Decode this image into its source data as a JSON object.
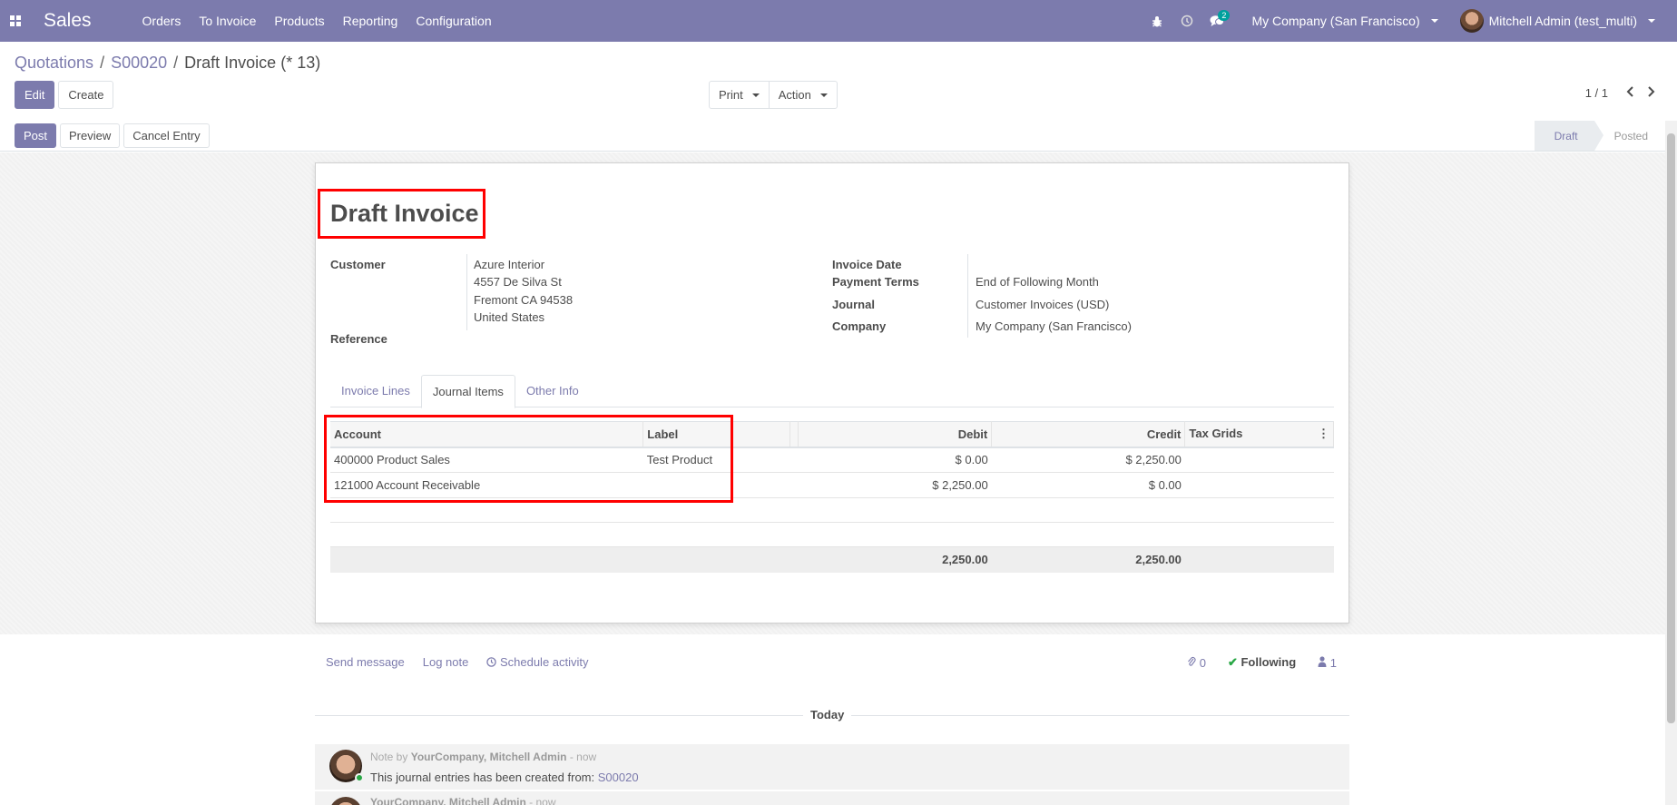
{
  "navbar": {
    "app_name": "Sales",
    "menu": [
      "Orders",
      "To Invoice",
      "Products",
      "Reporting",
      "Configuration"
    ],
    "messages_badge": "2",
    "company": "My Company (San Francisco)",
    "user": "Mitchell Admin (test_multi)",
    "bg_color": "#7c7bad"
  },
  "breadcrumb": {
    "items": [
      "Quotations",
      "S00020"
    ],
    "current": "Draft Invoice (* 13)"
  },
  "toolbar": {
    "edit": "Edit",
    "create": "Create",
    "print": "Print",
    "action": "Action",
    "pager": "1 / 1"
  },
  "statusbar": {
    "post": "Post",
    "preview": "Preview",
    "cancel_entry": "Cancel Entry",
    "steps": [
      "Draft",
      "Posted"
    ],
    "active_step": "Draft"
  },
  "invoice": {
    "title": "Draft Invoice",
    "customer_label": "Customer",
    "customer_name": "Azure Interior",
    "address": [
      "4557 De Silva St",
      "Fremont CA 94538",
      "United States"
    ],
    "reference_label": "Reference",
    "invoice_date_label": "Invoice Date",
    "payment_terms_label": "Payment Terms",
    "payment_terms": "End of Following Month",
    "journal_label": "Journal",
    "journal": "Customer Invoices (USD)",
    "company_label": "Company",
    "company": "My Company (San Francisco)"
  },
  "tabs": [
    "Invoice Lines",
    "Journal Items",
    "Other Info"
  ],
  "active_tab": "Journal Items",
  "journal_table": {
    "headers": [
      "Account",
      "Label",
      "",
      "Debit",
      "Credit",
      "Tax Grids"
    ],
    "rows": [
      {
        "account": "400000 Product Sales",
        "label": "Test Product",
        "debit": "$ 0.00",
        "credit": "$ 2,250.00",
        "tax": ""
      },
      {
        "account": "121000 Account Receivable",
        "label": "",
        "debit": "$ 2,250.00",
        "credit": "$ 0.00",
        "tax": ""
      }
    ],
    "total_debit": "2,250.00",
    "total_credit": "2,250.00"
  },
  "chatter": {
    "send_message": "Send message",
    "log_note": "Log note",
    "schedule_activity": "Schedule activity",
    "attachments": "0",
    "following": "Following",
    "followers": "1",
    "today": "Today",
    "messages": [
      {
        "prefix": "Note by",
        "author": "YourCompany, Mitchell Admin",
        "time": "- now",
        "body": "This journal entries has been created from:",
        "link": "S00020"
      },
      {
        "prefix": "",
        "author": "YourCompany, Mitchell Admin",
        "time": "- now",
        "body": "",
        "link": ""
      }
    ]
  }
}
